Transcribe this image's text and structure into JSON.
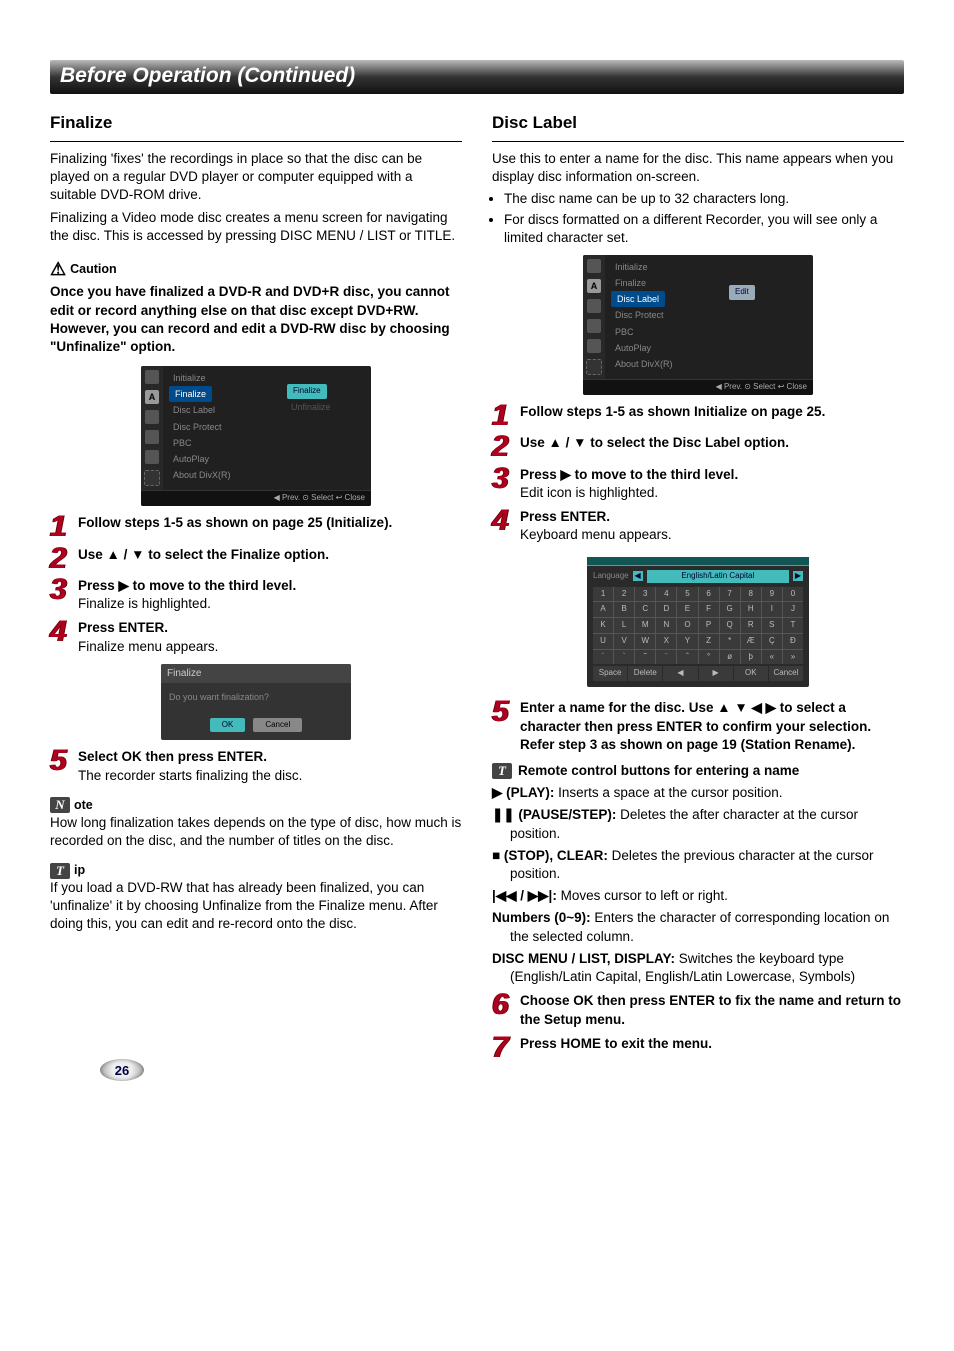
{
  "banner": "Before Operation (Continued)",
  "left": {
    "title": "Finalize",
    "intro1": "Finalizing 'fixes' the recordings in place so that the disc can be played on a regular DVD player or computer equipped with a suitable DVD-ROM drive.",
    "intro2": "Finalizing a Video mode disc creates a menu screen for navigating the disc. This is accessed by pressing DISC MENU / LIST or TITLE.",
    "caution_label": "Caution",
    "caution_body": "Once you have finalized a DVD-R and DVD+R disc, you cannot edit or record anything else on that disc except DVD+RW. However, you can record and edit a DVD-RW disc by choosing \"Unfinalize\" option.",
    "osd": {
      "items": [
        "Initialize",
        "Finalize",
        "Disc Label",
        "Disc Protect",
        "PBC",
        "AutoPlay",
        "About DivX(R)"
      ],
      "highlighted": "Finalize",
      "right_btn": "Finalize",
      "right_ghost": "Unfinalize",
      "footer": "◀ Prev.     ⊙ Select     ↩ Close"
    },
    "steps": [
      {
        "n": "1",
        "title": "Follow steps 1-5 as shown on page 25 (Initialize).",
        "desc": ""
      },
      {
        "n": "2",
        "title": "Use ▲ / ▼ to select the Finalize option.",
        "desc": ""
      },
      {
        "n": "3",
        "title": "Press ▶ to move to the third level.",
        "desc": "Finalize is highlighted."
      },
      {
        "n": "4",
        "title": "Press ENTER.",
        "desc": "Finalize menu appears."
      }
    ],
    "dialog": {
      "title": "Finalize",
      "question": "Do you want finalization?",
      "ok": "OK",
      "cancel": "Cancel"
    },
    "step5": {
      "n": "5",
      "title": "Select OK then press ENTER.",
      "desc": "The recorder starts finalizing the disc."
    },
    "note_label": "ote",
    "note_body": "How long finalization takes depends on the type of disc, how much is recorded on the disc, and the number of titles on the disc.",
    "tip_label": "ip",
    "tip_body": "If you load a DVD-RW that has already been finalized, you can 'unfinalize' it by choosing Unfinalize from the Finalize menu. After doing this, you can edit and re-record onto the disc."
  },
  "right": {
    "title": "Disc Label",
    "intro": "Use this to enter a name for the disc. This name appears when you display disc information on-screen.",
    "bullets": [
      "The disc name can be up to 32 characters long.",
      "For discs formatted on a different Recorder, you will see only a limited character set."
    ],
    "osd": {
      "items": [
        "Initialize",
        "Finalize",
        "Disc Label",
        "Disc Protect",
        "PBC",
        "AutoPlay",
        "About DivX(R)"
      ],
      "highlighted": "Disc Label",
      "right_btn": "Edit",
      "footer": "◀ Prev.     ⊙ Select     ↩ Close"
    },
    "steps_a": [
      {
        "n": "1",
        "title": "Follow steps 1-5 as shown Initialize on page 25.",
        "desc": ""
      },
      {
        "n": "2",
        "title": "Use ▲ / ▼ to select the Disc Label option.",
        "desc": ""
      },
      {
        "n": "3",
        "title": "Press ▶ to move to the third level.",
        "desc": "Edit icon is highlighted."
      },
      {
        "n": "4",
        "title": "Press ENTER.",
        "desc": "Keyboard menu appears."
      }
    ],
    "keyboard": {
      "lang_label": "Language",
      "lang_value": "English/Latin Capital",
      "rows": [
        [
          "1",
          "2",
          "3",
          "4",
          "5",
          "6",
          "7",
          "8",
          "9",
          "0"
        ],
        [
          "A",
          "B",
          "C",
          "D",
          "E",
          "F",
          "G",
          "H",
          "I",
          "J"
        ],
        [
          "K",
          "L",
          "M",
          "N",
          "O",
          "P",
          "Q",
          "R",
          "S",
          "T"
        ],
        [
          "U",
          "V",
          "W",
          "X",
          "Y",
          "Z",
          "*",
          "Æ",
          "Ç",
          "Đ"
        ],
        [
          "´",
          "`",
          "˜",
          "¨",
          "ˆ",
          "°",
          "ø",
          "þ",
          "«",
          "»"
        ]
      ],
      "bottom": [
        "Space",
        "Delete",
        "◀",
        "▶",
        "OK",
        "Cancel"
      ]
    },
    "step5": {
      "n": "5",
      "title": "Enter a name for the disc. Use ▲ ▼ ◀ ▶ to select a character then press ENTER to confirm your selection. Refer step 3 as shown on page 19 (Station Rename).",
      "desc": ""
    },
    "remote_head": "Remote control buttons for entering a name",
    "remote_items": [
      {
        "lead": "▶ (PLAY):",
        "text": " Inserts a space at the cursor position."
      },
      {
        "lead": "❚❚ (PAUSE/STEP):",
        "text": " Deletes the after character at the cursor position."
      },
      {
        "lead": "■ (STOP), CLEAR:",
        "text": " Deletes the previous character at the cursor position."
      },
      {
        "lead": "|◀◀ / ▶▶|:",
        "text": " Moves cursor to left or right."
      },
      {
        "lead": "Numbers (0~9):",
        "text": " Enters the character of corresponding location on the selected column."
      },
      {
        "lead": "DISC MENU / LIST, DISPLAY:",
        "text": " Switches the keyboard type (English/Latin Capital, English/Latin Lowercase, Symbols)"
      }
    ],
    "step6": {
      "n": "6",
      "title": "Choose OK then press ENTER to fix the name and return to the Setup menu.",
      "desc": ""
    },
    "step7": {
      "n": "7",
      "title": "Press HOME to exit the menu.",
      "desc": ""
    }
  },
  "page_number": "26"
}
